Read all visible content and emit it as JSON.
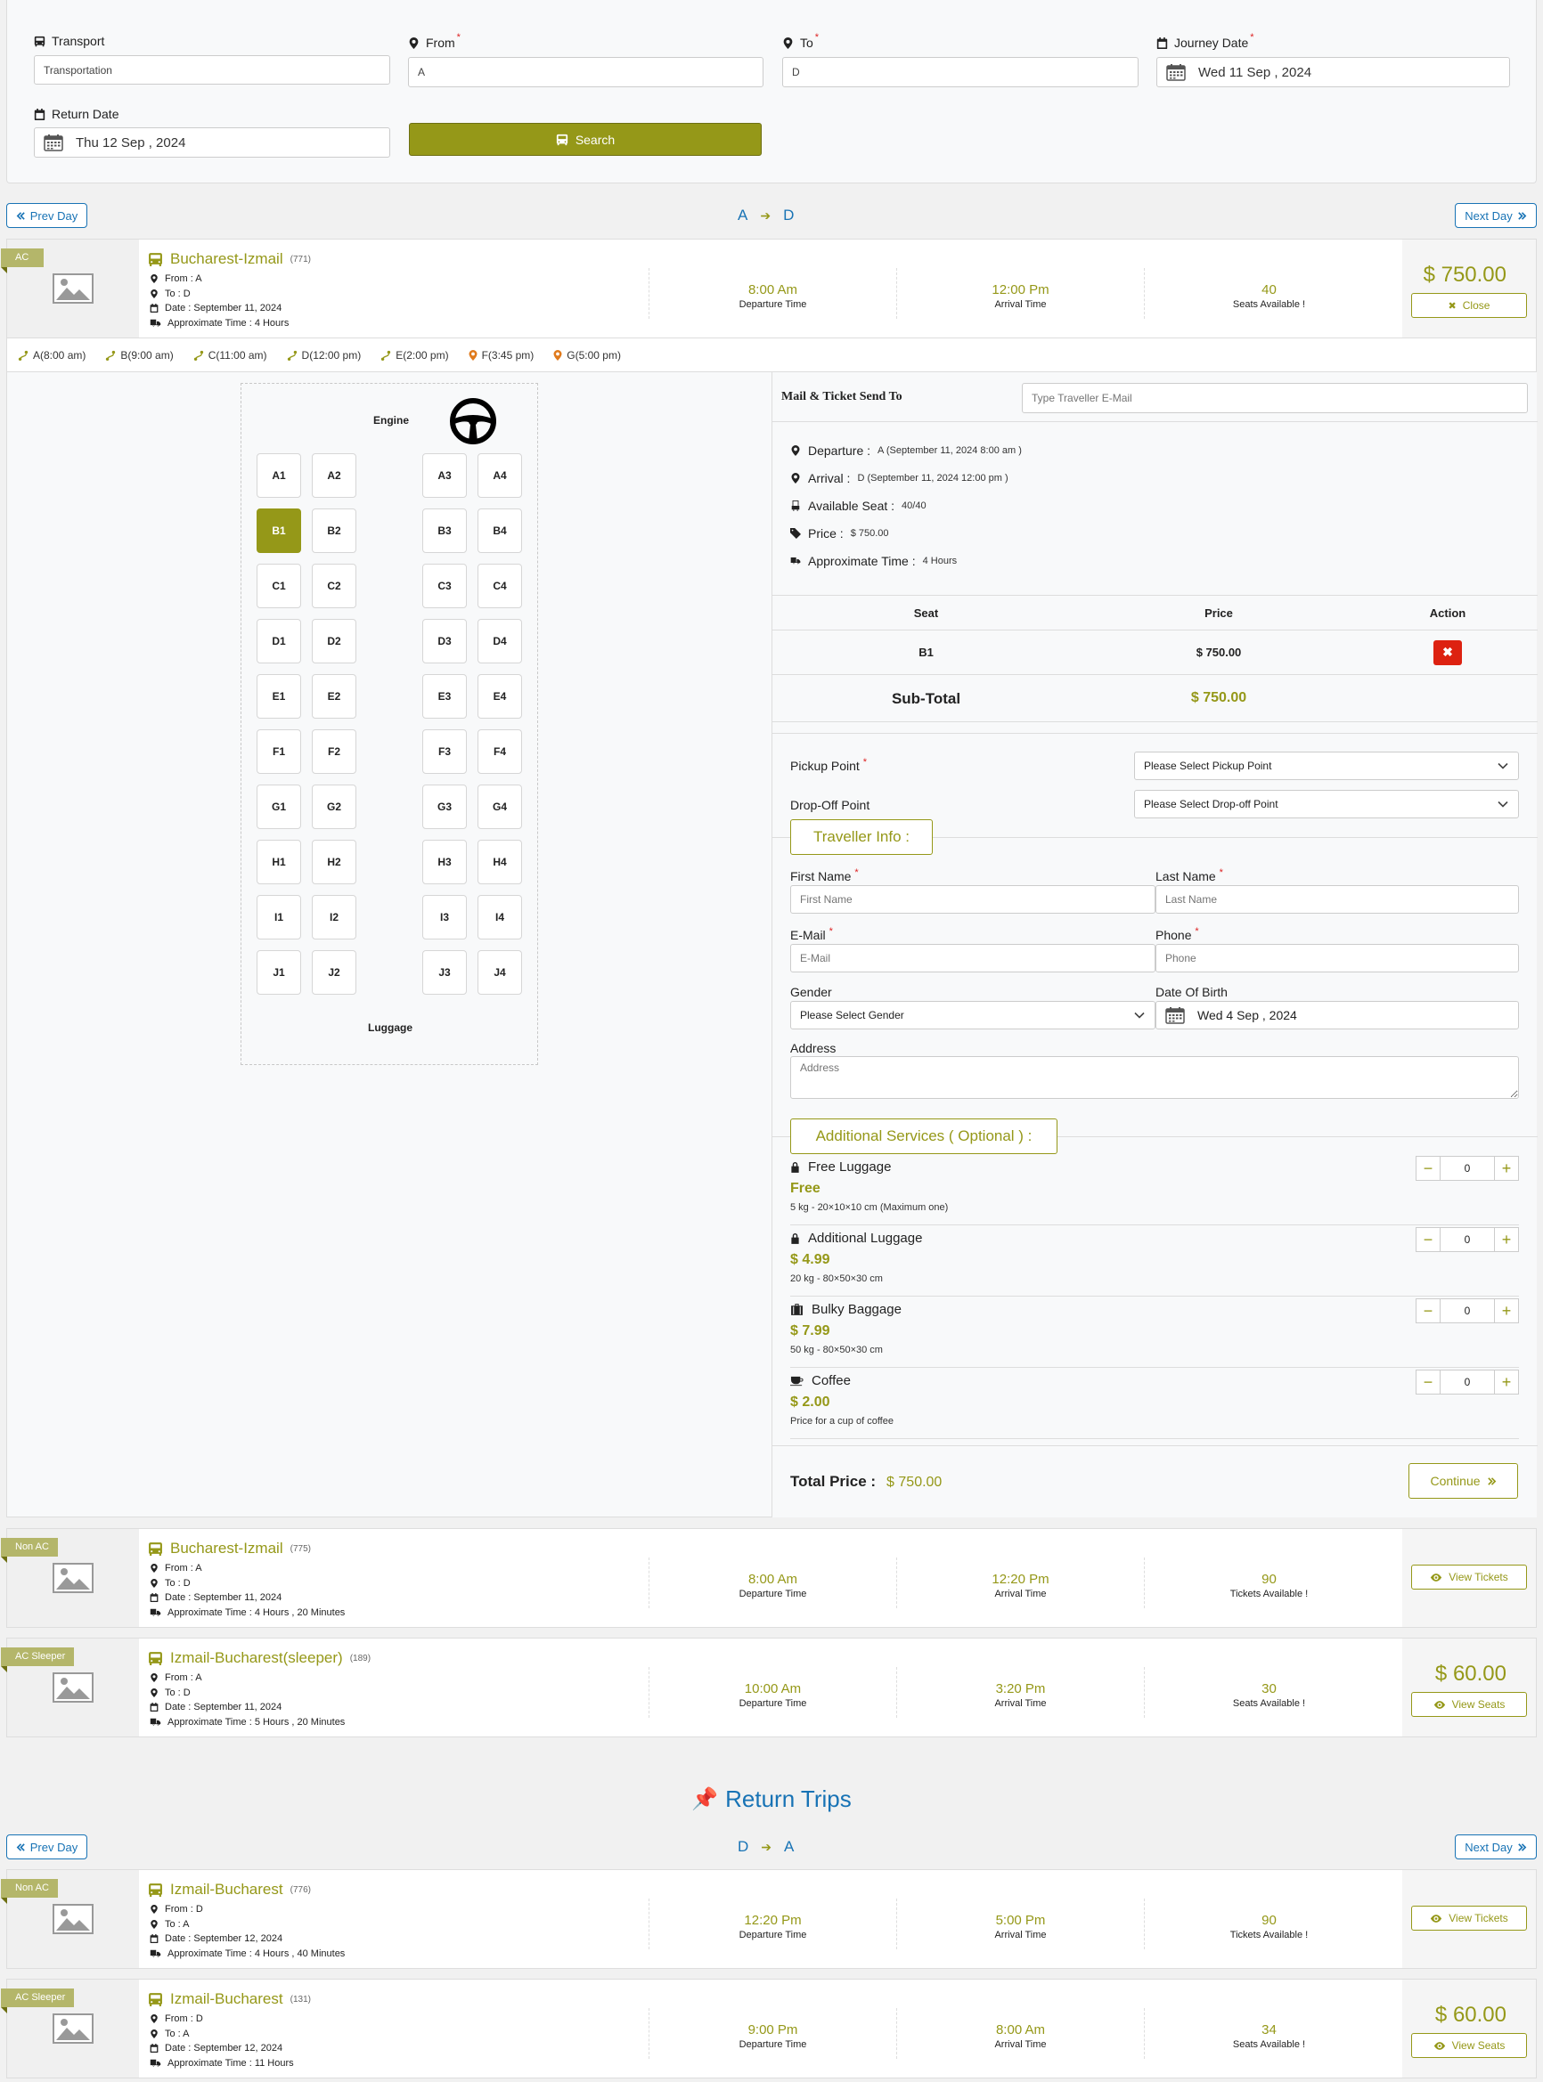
{
  "search": {
    "transport_label": "Transport",
    "transport_value": "Transportation",
    "from_label": "From",
    "from_value": "A",
    "to_label": "To",
    "to_value": "D",
    "journey_label": "Journey Date",
    "journey_value": "Wed 11 Sep , 2024",
    "return_label": "Return Date",
    "return_value": "Thu 12 Sep , 2024",
    "search_button": "Search",
    "required_mark": "*"
  },
  "outbound_nav": {
    "prev": "Prev Day",
    "next": "Next Day",
    "from": "A",
    "to": "D"
  },
  "return_nav": {
    "prev": "Prev Day",
    "next": "Next Day",
    "from": "D",
    "to": "A"
  },
  "return_title": "Return Trips",
  "trips": [
    {
      "tag": "AC",
      "name": "Bucharest-Izmail",
      "code": "(771)",
      "from": "From : A",
      "to": "To : D",
      "date": "Date : September 11, 2024",
      "approx": "Approximate Time : 4 Hours",
      "departure": "8:00 Am",
      "departure_label": "Departure Time",
      "arrival": "12:00 Pm",
      "arrival_label": "Arrival Time",
      "seats": "40",
      "seats_label": "Seats Available !",
      "price": "$ 750.00",
      "button": "Close"
    },
    {
      "tag": "Non AC",
      "name": "Bucharest-Izmail",
      "code": "(775)",
      "from": "From : A",
      "to": "To : D",
      "date": "Date : September 11, 2024",
      "approx": "Approximate Time : 4 Hours , 20 Minutes",
      "departure": "8:00 Am",
      "departure_label": "Departure Time",
      "arrival": "12:20 Pm",
      "arrival_label": "Arrival Time",
      "seats": "90",
      "seats_label": "Tickets Available !",
      "price": "",
      "button": "View Tickets"
    },
    {
      "tag": "AC Sleeper",
      "name": "Izmail-Bucharest(sleeper)",
      "code": "(189)",
      "from": "From : A",
      "to": "To : D",
      "date": "Date : September 11, 2024",
      "approx": "Approximate Time : 5 Hours , 20 Minutes",
      "departure": "10:00 Am",
      "departure_label": "Departure Time",
      "arrival": "3:20 Pm",
      "arrival_label": "Arrival Time",
      "seats": "30",
      "seats_label": "Seats Available !",
      "price": "$ 60.00",
      "button": "View Seats"
    },
    {
      "tag": "Non AC",
      "name": "Izmail-Bucharest",
      "code": "(776)",
      "from": "From : D",
      "to": "To : A",
      "date": "Date : September 12, 2024",
      "approx": "Approximate Time : 4 Hours , 40 Minutes",
      "departure": "12:20 Pm",
      "departure_label": "Departure Time",
      "arrival": "5:00 Pm",
      "arrival_label": "Arrival Time",
      "seats": "90",
      "seats_label": "Tickets Available !",
      "price": "",
      "button": "View Tickets"
    },
    {
      "tag": "AC Sleeper",
      "name": "Izmail-Bucharest",
      "code": "(131)",
      "from": "From : D",
      "to": "To : A",
      "date": "Date : September 12, 2024",
      "approx": "Approximate Time : 11 Hours",
      "departure": "9:00 Pm",
      "departure_label": "Departure Time",
      "arrival": "8:00 Am",
      "arrival_label": "Arrival Time",
      "seats": "34",
      "seats_label": "Seats Available !",
      "price": "$ 60.00",
      "button": "View Seats"
    }
  ],
  "stops": [
    "A(8:00 am)",
    "B(9:00 am)",
    "C(11:00 am)",
    "D(12:00 pm)",
    "E(2:00 pm)",
    "F(3:45 pm)",
    "G(5:00 pm)"
  ],
  "seatmap": {
    "engine": "Engine",
    "luggage": "Luggage",
    "rows": [
      [
        "A1",
        "A2",
        "A3",
        "A4"
      ],
      [
        "B1",
        "B2",
        "B3",
        "B4"
      ],
      [
        "C1",
        "C2",
        "C3",
        "C4"
      ],
      [
        "D1",
        "D2",
        "D3",
        "D4"
      ],
      [
        "E1",
        "E2",
        "E3",
        "E4"
      ],
      [
        "F1",
        "F2",
        "F3",
        "F4"
      ],
      [
        "G1",
        "G2",
        "G3",
        "G4"
      ],
      [
        "H1",
        "H2",
        "H3",
        "H4"
      ],
      [
        "I1",
        "I2",
        "I3",
        "I4"
      ],
      [
        "J1",
        "J2",
        "J3",
        "J4"
      ]
    ],
    "selected": "B1"
  },
  "booking": {
    "mail_label": "Mail & Ticket Send To",
    "mail_placeholder": "Type Traveller E-Mail",
    "departure_label": "Departure :",
    "departure_value": "A (September 11, 2024 8:00 am )",
    "arrival_label": "Arrival :",
    "arrival_value": "D (September 11, 2024 12:00 pm )",
    "available_label": "Available Seat :",
    "available_value": "40/40",
    "price_label": "Price :",
    "price_value": "$ 750.00",
    "approx_label": "Approximate Time :",
    "approx_value": "4 Hours",
    "table_headers": [
      "Seat",
      "Price",
      "Action"
    ],
    "table_row": {
      "seat": "B1",
      "price": "$ 750.00"
    },
    "subtotal_label": "Sub-Total",
    "subtotal_value": "$ 750.00",
    "pickup_label": "Pickup Point",
    "pickup_value": "Please Select Pickup Point",
    "dropoff_label": "Drop-Off Point",
    "dropoff_value": "Please Select Drop-off Point",
    "traveller_title": "Traveller Info :",
    "first_name_label": "First Name",
    "first_name_placeholder": "First Name",
    "last_name_label": "Last Name",
    "last_name_placeholder": "Last Name",
    "email_label": "E-Mail",
    "email_placeholder": "E-Mail",
    "phone_label": "Phone",
    "phone_placeholder": "Phone",
    "gender_label": "Gender",
    "gender_value": "Please Select Gender",
    "dob_label": "Date Of Birth",
    "dob_value": "Wed 4 Sep , 2024",
    "address_label": "Address",
    "address_placeholder": "Address",
    "services_title": "Additional Services ( Optional ) :",
    "services": [
      {
        "icon": "lock-icon",
        "name": "Free Luggage",
        "price": "Free",
        "desc": "5 kg - 20×10×10 cm (Maximum one)",
        "qty": "0"
      },
      {
        "icon": "lock-icon",
        "name": "Additional Luggage",
        "price": "$ 4.99",
        "desc": "20 kg - 80×50×30 cm",
        "qty": "0"
      },
      {
        "icon": "suitcase-icon",
        "name": "Bulky Baggage",
        "price": "$ 7.99",
        "desc": "50 kg - 80×50×30 cm",
        "qty": "0"
      },
      {
        "icon": "coffee-icon",
        "name": "Coffee",
        "price": "$ 2.00",
        "desc": "Price for a cup of coffee",
        "qty": "0"
      }
    ],
    "total_label": "Total Price :",
    "total_value": "$ 750.00",
    "continue_button": "Continue"
  },
  "colors": {
    "accent": "#959818",
    "blue": "#1873b5",
    "danger": "#dd2211",
    "tag": "#b4b66a"
  }
}
